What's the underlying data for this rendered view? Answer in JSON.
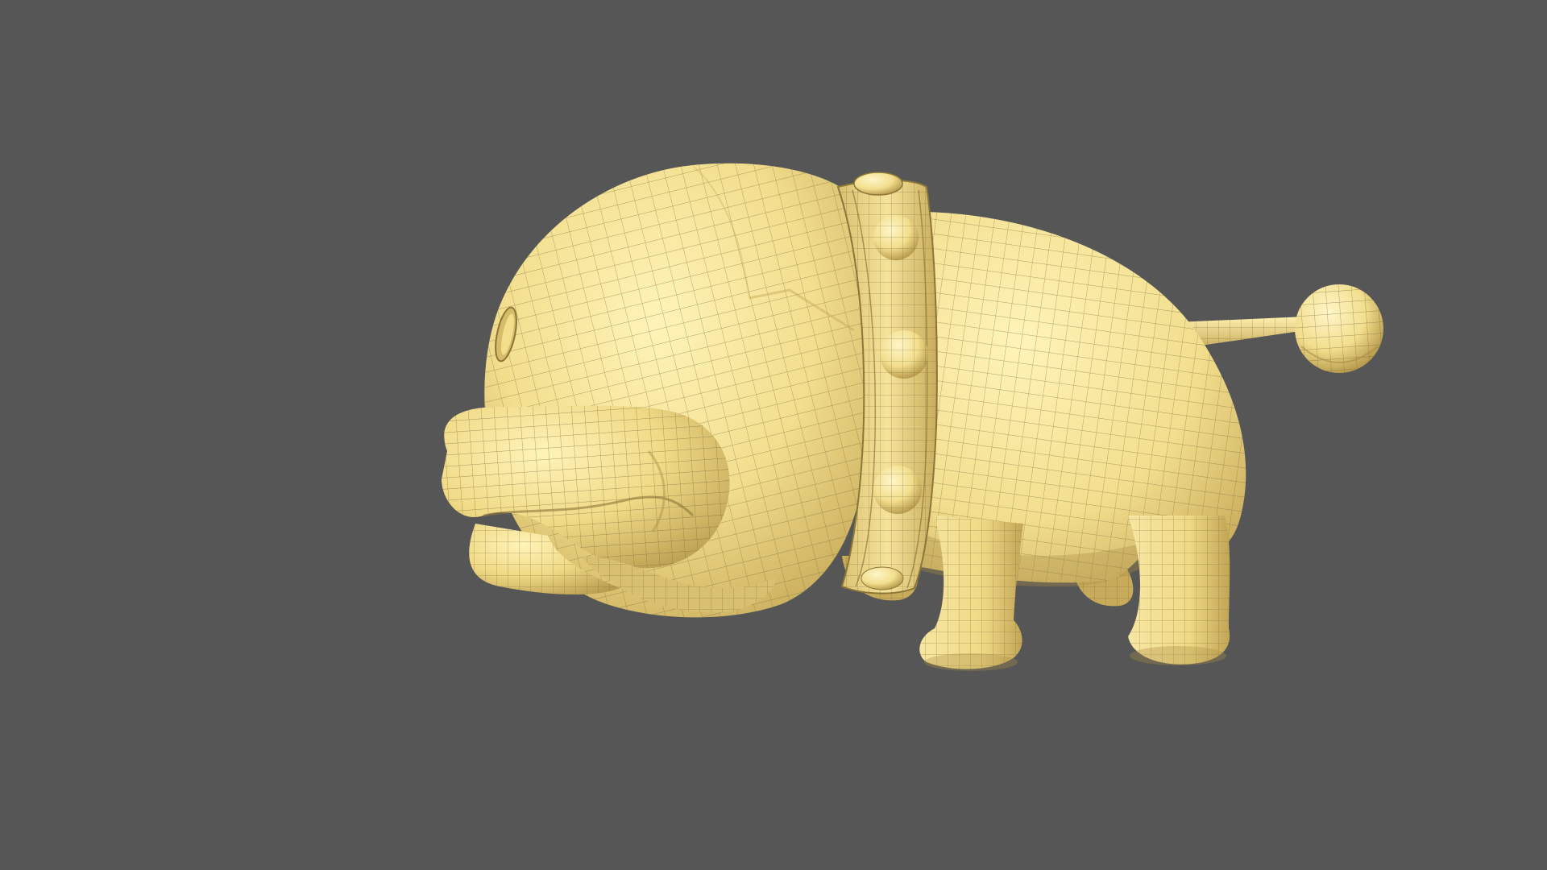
{
  "viewport": {
    "background_color": "#565656"
  },
  "model": {
    "subject": "stylized-dog-creature-3d-mesh",
    "display_mode": "shaded-wireframe",
    "colors": {
      "base": "#f2de8d",
      "shadow": "#c8ab5a",
      "deep_shadow": "#a88d44",
      "highlight": "#fff3b8",
      "wire": "#6f6236"
    },
    "parts": [
      "head",
      "muzzle",
      "tongue",
      "eye",
      "collar",
      "collar-studs",
      "body",
      "front-leg",
      "hind-leg",
      "far-legs",
      "tail",
      "tail-ball"
    ]
  }
}
